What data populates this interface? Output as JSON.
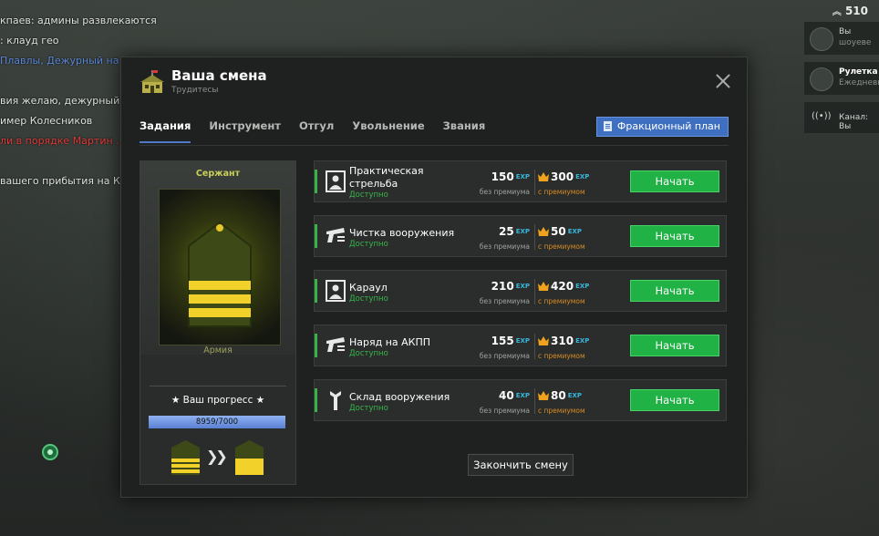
{
  "background": {
    "chat_lines": [
      {
        "text": "кпаев: админы развлекаются",
        "color": "white"
      },
      {
        "text": ": клауд гео",
        "color": "white"
      },
      {
        "text": "Плавлы, Дежурный на ...",
        "color": "blue"
      },
      {
        "text": "",
        "color": "white"
      },
      {
        "text": "вия желаю, дежурный по",
        "color": "white"
      },
      {
        "text": "имер Колесников",
        "color": "white"
      },
      {
        "text": "ли в порядке Мартин ...",
        "color": "red"
      },
      {
        "text": "",
        "color": "white"
      },
      {
        "text": "вашего прибытия на КП",
        "color": "white"
      }
    ],
    "hud": {
      "money": "510",
      "cards": [
        {
          "label": "Вы",
          "sub": "шоуеве"
        },
        {
          "label": "Рулетка",
          "sub": "Ежедневно"
        },
        {
          "label": "Канал: Вы",
          "sub": ""
        }
      ]
    }
  },
  "modal": {
    "title": "Ваша смена",
    "subtitle": "Трудитесы",
    "tabs": [
      "Задания",
      "Инструмент",
      "Отгул",
      "Увольнение",
      "Звания"
    ],
    "active_tab": 0,
    "plan_button": "Фракционный план",
    "rank": {
      "name": "Сержант",
      "faction": "Армия",
      "progress_title": "★ Ваш прогресс ★",
      "progress_text": "8959/7000",
      "progress_fraction": 1.0
    },
    "exp_label": "EXP",
    "tasks": [
      {
        "name": "Практическая стрельба",
        "status": "Доступно",
        "exp_free": "150",
        "free_label": "без премиума",
        "exp_premium": "300",
        "premium_label": "с премиумом",
        "button": "Начать",
        "icon": "target-icon"
      },
      {
        "name": "Чистка вооружения",
        "status": "Доступно",
        "exp_free": "25",
        "free_label": "без премиума",
        "exp_premium": "50",
        "premium_label": "с премиумом",
        "button": "Начать",
        "icon": "pistol-icon"
      },
      {
        "name": "Караул",
        "status": "Доступно",
        "exp_free": "210",
        "free_label": "без премиума",
        "exp_premium": "420",
        "premium_label": "с премиумом",
        "button": "Начать",
        "icon": "target-icon"
      },
      {
        "name": "Наряд на АКПП",
        "status": "Доступно",
        "exp_free": "155",
        "free_label": "без премиума",
        "exp_premium": "310",
        "premium_label": "с премиумом",
        "button": "Начать",
        "icon": "pistol-icon"
      },
      {
        "name": "Склад вооружения",
        "status": "Доступно",
        "exp_free": "40",
        "free_label": "без премиума",
        "exp_premium": "80",
        "premium_label": "с премиумом",
        "button": "Начать",
        "icon": "wrench-icon"
      }
    ],
    "finish_button": "Закончить смену"
  }
}
